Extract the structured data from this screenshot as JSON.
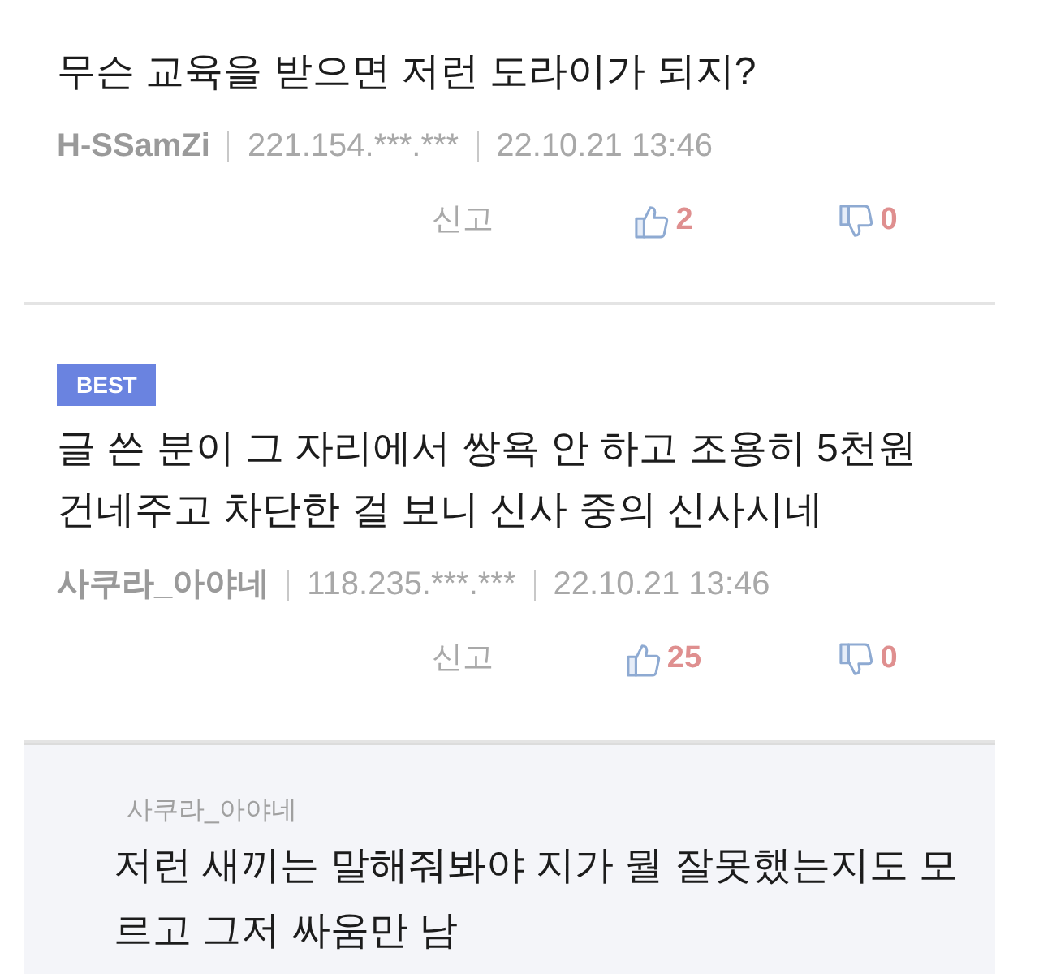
{
  "comments": [
    {
      "lines": [
        "무슨 교육을 받으면 저런 도라이가 되지?"
      ],
      "author": "H-SSamZi",
      "ip": "221.154.***.***",
      "date": "22.10.21 13:46",
      "report": "신고",
      "likes": "2",
      "dislikes": "0"
    },
    {
      "badge": "BEST",
      "lines": [
        "글 쓴 분이 그 자리에서 쌍욕 안 하고 조용히 5천원",
        "건네주고 차단한 걸 보니 신사 중의 신사시네"
      ],
      "author": "사쿠라_아야네",
      "ip": "118.235.***.***",
      "date": "22.10.21 13:46",
      "report": "신고",
      "likes": "25",
      "dislikes": "0"
    }
  ],
  "reply": {
    "author": "사쿠라_아야네",
    "lines": [
      "저런 새끼는 말해줘봐야 지가 뭘 잘못했는지도 모",
      "르고 그저 싸움만 남"
    ]
  }
}
